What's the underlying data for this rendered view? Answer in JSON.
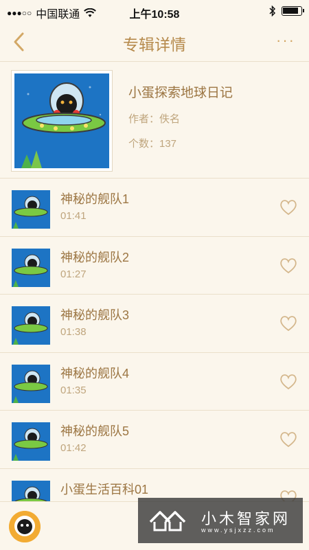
{
  "status_bar": {
    "carrier": "中国联通",
    "time": "上午10:58",
    "signal_dots": "●●●○○"
  },
  "nav": {
    "title": "专辑详情",
    "more": "···"
  },
  "album": {
    "title": "小蛋探索地球日记",
    "author": "作者：佚名",
    "count": "个数：137"
  },
  "tracks": [
    {
      "name": "神秘的舰队1",
      "duration": "01:41"
    },
    {
      "name": "神秘的舰队2",
      "duration": "01:27"
    },
    {
      "name": "神秘的舰队3",
      "duration": "01:38"
    },
    {
      "name": "神秘的舰队4",
      "duration": "01:35"
    },
    {
      "name": "神秘的舰队5",
      "duration": "01:42"
    },
    {
      "name": "小蛋生活百科01",
      "duration": ""
    }
  ],
  "watermark": {
    "name": "小木智家网",
    "url": "www.ysjxzz.com"
  },
  "colors": {
    "background": "#fbf6ec",
    "accent": "#b68a4c",
    "heart": "#d4b78c",
    "cover_blue": "#1d74c4"
  }
}
